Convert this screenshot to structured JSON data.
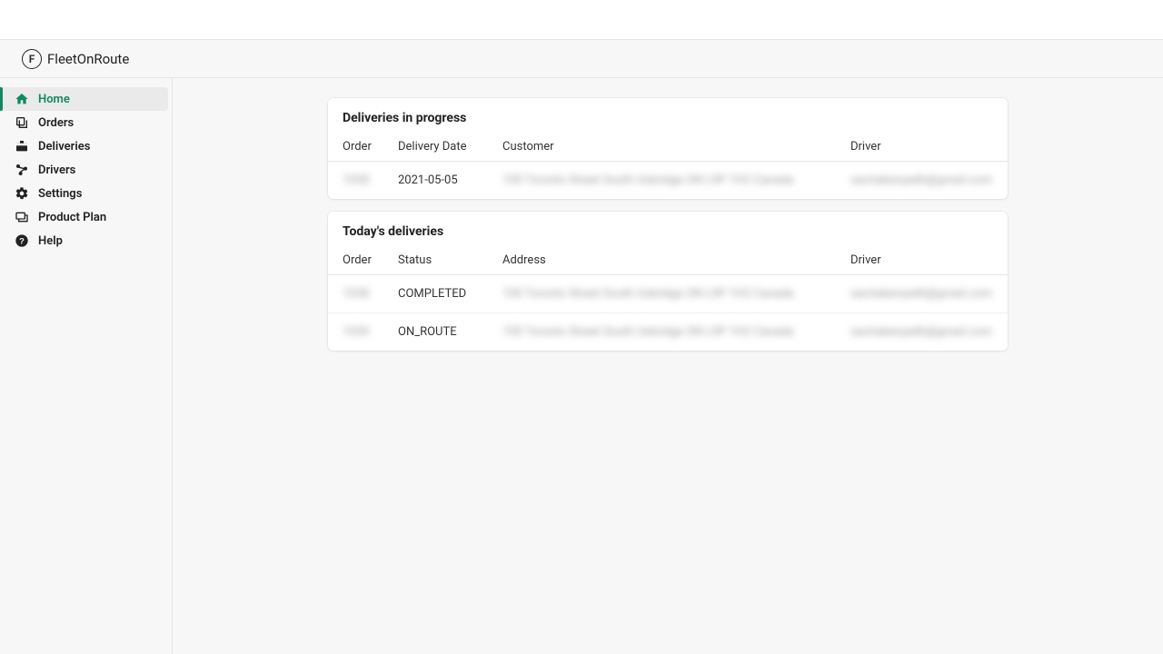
{
  "brand": "FleetOnRoute",
  "logo_letter": "F",
  "nav": [
    {
      "id": "home",
      "label": "Home",
      "icon": "home"
    },
    {
      "id": "orders",
      "label": "Orders",
      "icon": "orders"
    },
    {
      "id": "deliveries",
      "label": "Deliveries",
      "icon": "deliveries"
    },
    {
      "id": "drivers",
      "label": "Drivers",
      "icon": "drivers"
    },
    {
      "id": "settings",
      "label": "Settings",
      "icon": "settings"
    },
    {
      "id": "productplan",
      "label": "Product Plan",
      "icon": "product-plan"
    },
    {
      "id": "help",
      "label": "Help",
      "icon": "help"
    }
  ],
  "active_nav": "home",
  "cards": {
    "in_progress": {
      "title": "Deliveries in progress",
      "columns": [
        "Order",
        "Delivery Date",
        "Customer",
        "Driver"
      ],
      "rows": [
        {
          "order": "1038",
          "date": "2021-05-05",
          "customer": "100 Toronto Street South Uxbridge ON L9P 1H2 Canada",
          "driver": "sachakenyadh@gmail.com"
        }
      ]
    },
    "today": {
      "title": "Today's deliveries",
      "columns": [
        "Order",
        "Status",
        "Address",
        "Driver"
      ],
      "rows": [
        {
          "order": "1038",
          "status": "COMPLETED",
          "address": "100 Toronto Street South Uxbridge ON L9P 1H2 Canada",
          "driver": "sachakenyadh@gmail.com"
        },
        {
          "order": "1039",
          "status": "ON_ROUTE",
          "address": "100 Toronto Street South Uxbridge ON L9P 1H2 Canada",
          "driver": "sachakenyadh@gmail.com"
        }
      ]
    }
  }
}
